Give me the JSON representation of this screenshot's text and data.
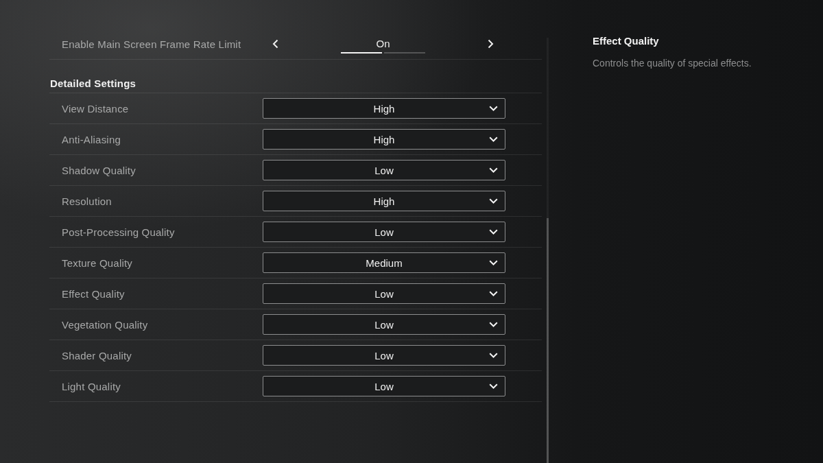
{
  "frame_rate_limit": {
    "label": "Enable Main Screen Frame Rate Limit",
    "value": "On",
    "segments": [
      {
        "selected": true
      },
      {
        "selected": false
      }
    ]
  },
  "detailed_settings": {
    "heading": "Detailed Settings",
    "rows": [
      {
        "label": "View Distance",
        "value": "High"
      },
      {
        "label": "Anti-Aliasing",
        "value": "High"
      },
      {
        "label": "Shadow Quality",
        "value": "Low"
      },
      {
        "label": "Resolution",
        "value": "High"
      },
      {
        "label": "Post-Processing Quality",
        "value": "Low"
      },
      {
        "label": "Texture Quality",
        "value": "Medium"
      },
      {
        "label": "Effect Quality",
        "value": "Low"
      },
      {
        "label": "Vegetation Quality",
        "value": "Low"
      },
      {
        "label": "Shader Quality",
        "value": "Low"
      },
      {
        "label": "Light Quality",
        "value": "Low"
      }
    ]
  },
  "description_panel": {
    "title": "Effect Quality",
    "text": "Controls the quality of special effects."
  }
}
